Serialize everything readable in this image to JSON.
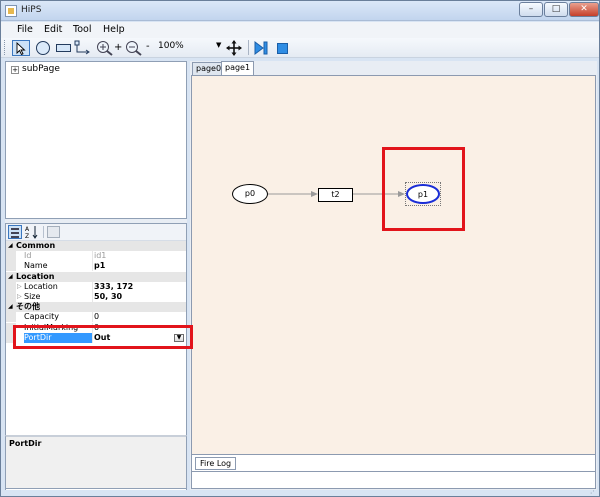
{
  "window": {
    "title": "HiPS",
    "min_label": "–",
    "max_label": "□",
    "close_label": "✕"
  },
  "menu": [
    "File",
    "Edit",
    "Tool",
    "Help"
  ],
  "toolbar": {
    "zoom_in_label": "+",
    "zoom_out_label": "-",
    "zoom_value": "100%",
    "zoom_arrow": "▼"
  },
  "tree": {
    "expander": "+",
    "root_label": "subPage"
  },
  "properties": {
    "sort_icon_text": "A\nZ",
    "categories": [
      {
        "label": "Common",
        "rows": [
          {
            "key": "Id",
            "value": "id1",
            "readonly": true
          },
          {
            "key": "Name",
            "value": "p1"
          }
        ]
      },
      {
        "label": "Location",
        "rows": [
          {
            "key": "Location",
            "value": "333, 172",
            "expandable": true
          },
          {
            "key": "Size",
            "value": "50, 30",
            "expandable": true
          }
        ]
      },
      {
        "label": "その他",
        "rows": [
          {
            "key": "Capacity",
            "value": "0"
          },
          {
            "key": "InitialMarking",
            "value": "0"
          },
          {
            "key": "PortDir",
            "value": "Out",
            "selected": true,
            "dropdown": true
          }
        ]
      }
    ],
    "description_title": "PortDir"
  },
  "tabs": [
    "page0",
    "page1"
  ],
  "active_tab": "page1",
  "canvas": {
    "places": [
      {
        "label": "p0"
      },
      {
        "label": "p1"
      }
    ],
    "transitions": [
      {
        "label": "t2"
      }
    ]
  },
  "bottom_tab": "Fire Log",
  "colors": {
    "canvas_bg": "#faf0e6",
    "highlight": "#e2141b",
    "selected_place_border": "#1a2dd6",
    "selection_blue": "#3399ff"
  }
}
